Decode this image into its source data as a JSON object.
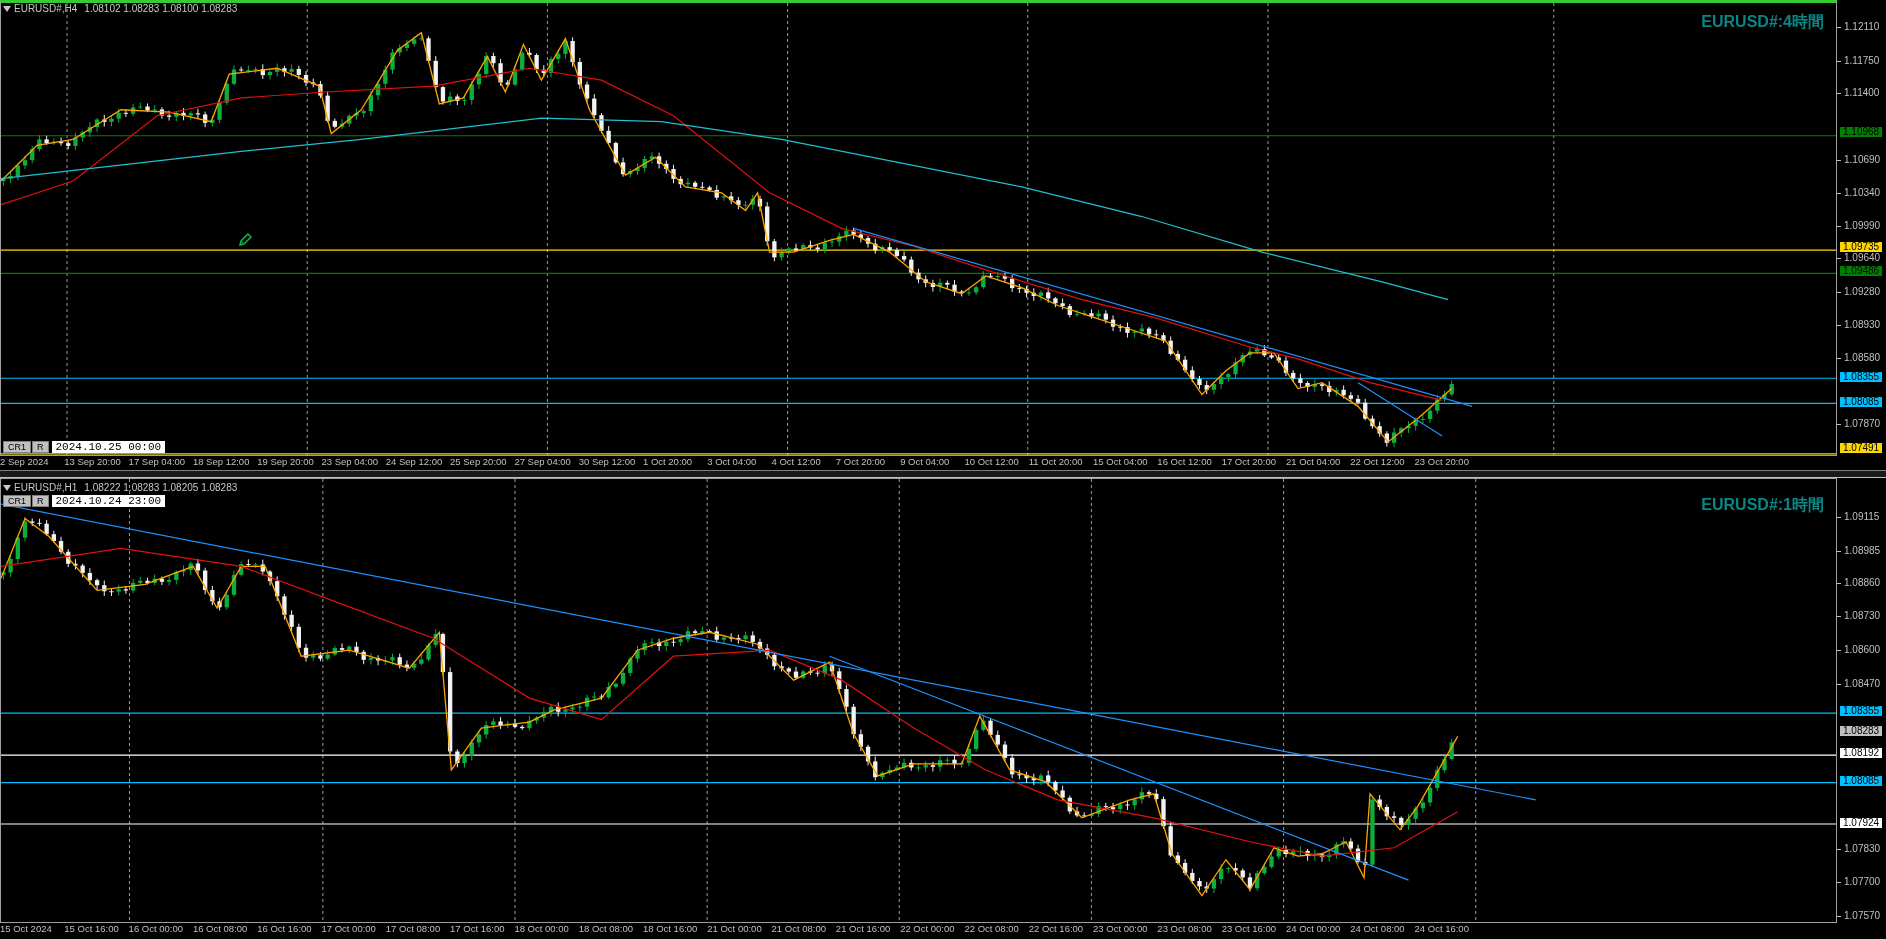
{
  "charts": [
    {
      "symbol": "EURUSD#,H4",
      "ohlc": "1.08102 1.08283 1.08100 1.08283",
      "title": "EURUSD#:4時間",
      "date_bar": {
        "buttons": [
          "CR1",
          "R"
        ],
        "date": "2024.10.25 00:00"
      },
      "price_ticks": [
        "1.12110",
        "1.11750",
        "1.11400",
        "1.10690",
        "1.10340",
        "1.09990",
        "1.09640",
        "1.09280",
        "1.08930",
        "1.08580",
        "1.07870"
      ],
      "price_levels": [
        {
          "price": "1.10968",
          "color": "#008000"
        },
        {
          "price": "1.09735",
          "color": "#ffd700"
        },
        {
          "price": "1.09486",
          "color": "#008000"
        },
        {
          "price": "1.08355",
          "color": "#00bfff"
        },
        {
          "price": "1.08085",
          "color": "#00bfff"
        },
        {
          "price": "1.07491",
          "color": "#ffd700"
        }
      ],
      "time_labels": [
        "2 Sep 2024",
        "13 Sep 20:00",
        "17 Sep 04:00",
        "18 Sep 12:00",
        "19 Sep 20:00",
        "23 Sep 04:00",
        "24 Sep 12:00",
        "25 Sep 20:00",
        "27 Sep 04:00",
        "30 Sep 12:00",
        "1 Oct 20:00",
        "3 Oct 04:00",
        "4 Oct 12:00",
        "7 Oct 20:00",
        "9 Oct 04:00",
        "10 Oct 12:00",
        "11 Oct 20:00",
        "15 Oct 04:00",
        "16 Oct 12:00",
        "17 Oct 20:00",
        "21 Oct 04:00",
        "22 Oct 12:00",
        "23 Oct 20:00"
      ]
    },
    {
      "symbol": "EURUSD#,H1",
      "ohlc": "1.08222 1.08283 1.08205 1.08283",
      "title": "EURUSD#:1時間",
      "date_bar": {
        "buttons": [
          "CR1",
          "R"
        ],
        "date": "2024.10.24 23:00"
      },
      "price_ticks": [
        "1.09115",
        "1.08985",
        "1.08860",
        "1.08730",
        "1.08600",
        "1.08470",
        "1.07830",
        "1.07700",
        "1.07570"
      ],
      "current_price": "1.08283",
      "price_levels": [
        {
          "price": "1.08355",
          "color": "#00bfff"
        },
        {
          "price": "1.08192",
          "color": "#ffffff"
        },
        {
          "price": "1.08085",
          "color": "#00bfff"
        },
        {
          "price": "1.07924",
          "color": "#ffffff"
        }
      ],
      "time_labels": [
        "15 Oct 2024",
        "15 Oct 16:00",
        "16 Oct 00:00",
        "16 Oct 08:00",
        "16 Oct 16:00",
        "17 Oct 00:00",
        "17 Oct 08:00",
        "17 Oct 16:00",
        "18 Oct 00:00",
        "18 Oct 08:00",
        "18 Oct 16:00",
        "21 Oct 00:00",
        "21 Oct 08:00",
        "21 Oct 16:00",
        "22 Oct 00:00",
        "22 Oct 08:00",
        "22 Oct 16:00",
        "23 Oct 00:00",
        "23 Oct 08:00",
        "23 Oct 16:00",
        "24 Oct 00:00",
        "24 Oct 08:00",
        "24 Oct 16:00"
      ]
    }
  ]
}
